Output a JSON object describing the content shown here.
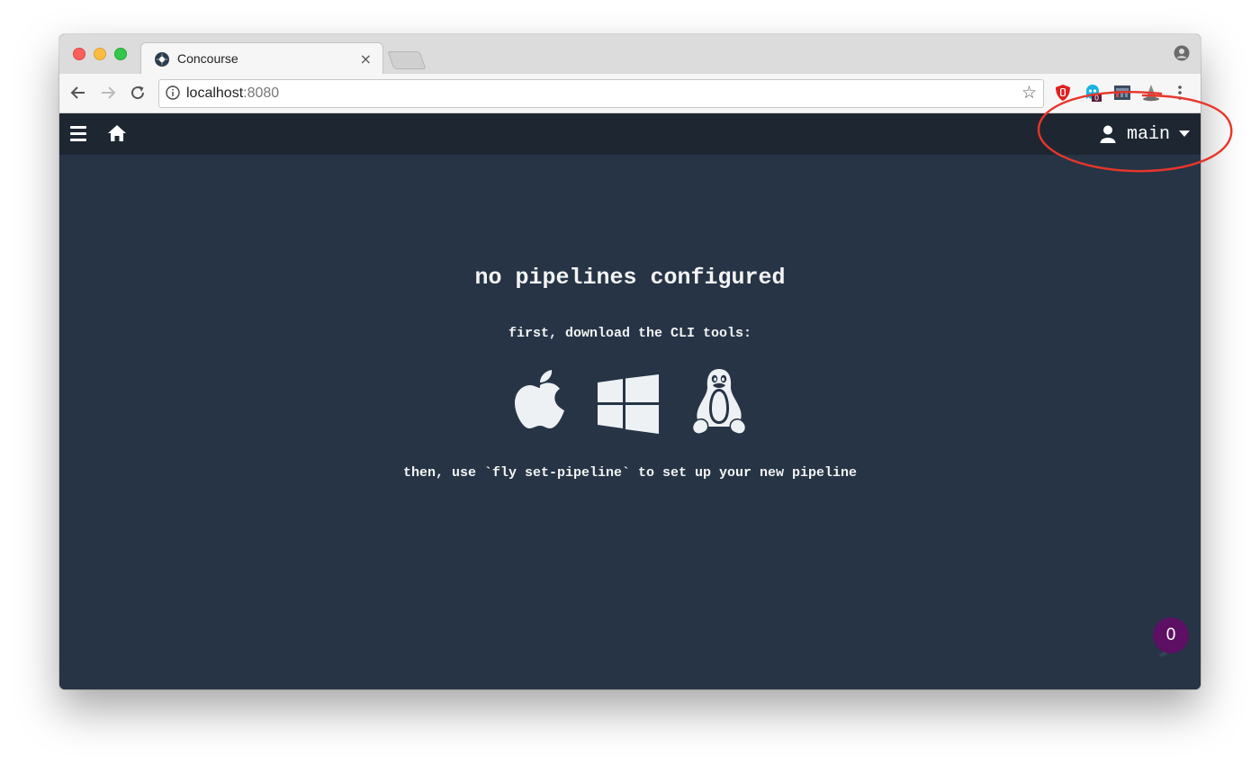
{
  "browser": {
    "tab": {
      "title": "Concourse",
      "close_glyph": "×"
    },
    "address_bar": {
      "host": "localhost",
      "port": ":8080"
    },
    "bookmark_glyph": "☆",
    "extensions": [
      "ublock-icon",
      "ghostery-icon",
      "onenote-clipper-icon",
      "dashlane-icon",
      "wizard-hat-icon"
    ]
  },
  "topbar": {
    "user": {
      "team_name": "main"
    }
  },
  "empty_state": {
    "title": "no pipelines configured",
    "download_prompt": "first, download the CLI tools:",
    "cli_downloads": [
      "apple-logo-icon",
      "windows-logo-icon",
      "linux-tux-icon"
    ],
    "then_text": "then, use `fly set-pipeline` to set up your new pipeline"
  },
  "notification_badge": {
    "count": "0",
    "color": "#5c0f63"
  },
  "annotation_color": "#e8362a"
}
